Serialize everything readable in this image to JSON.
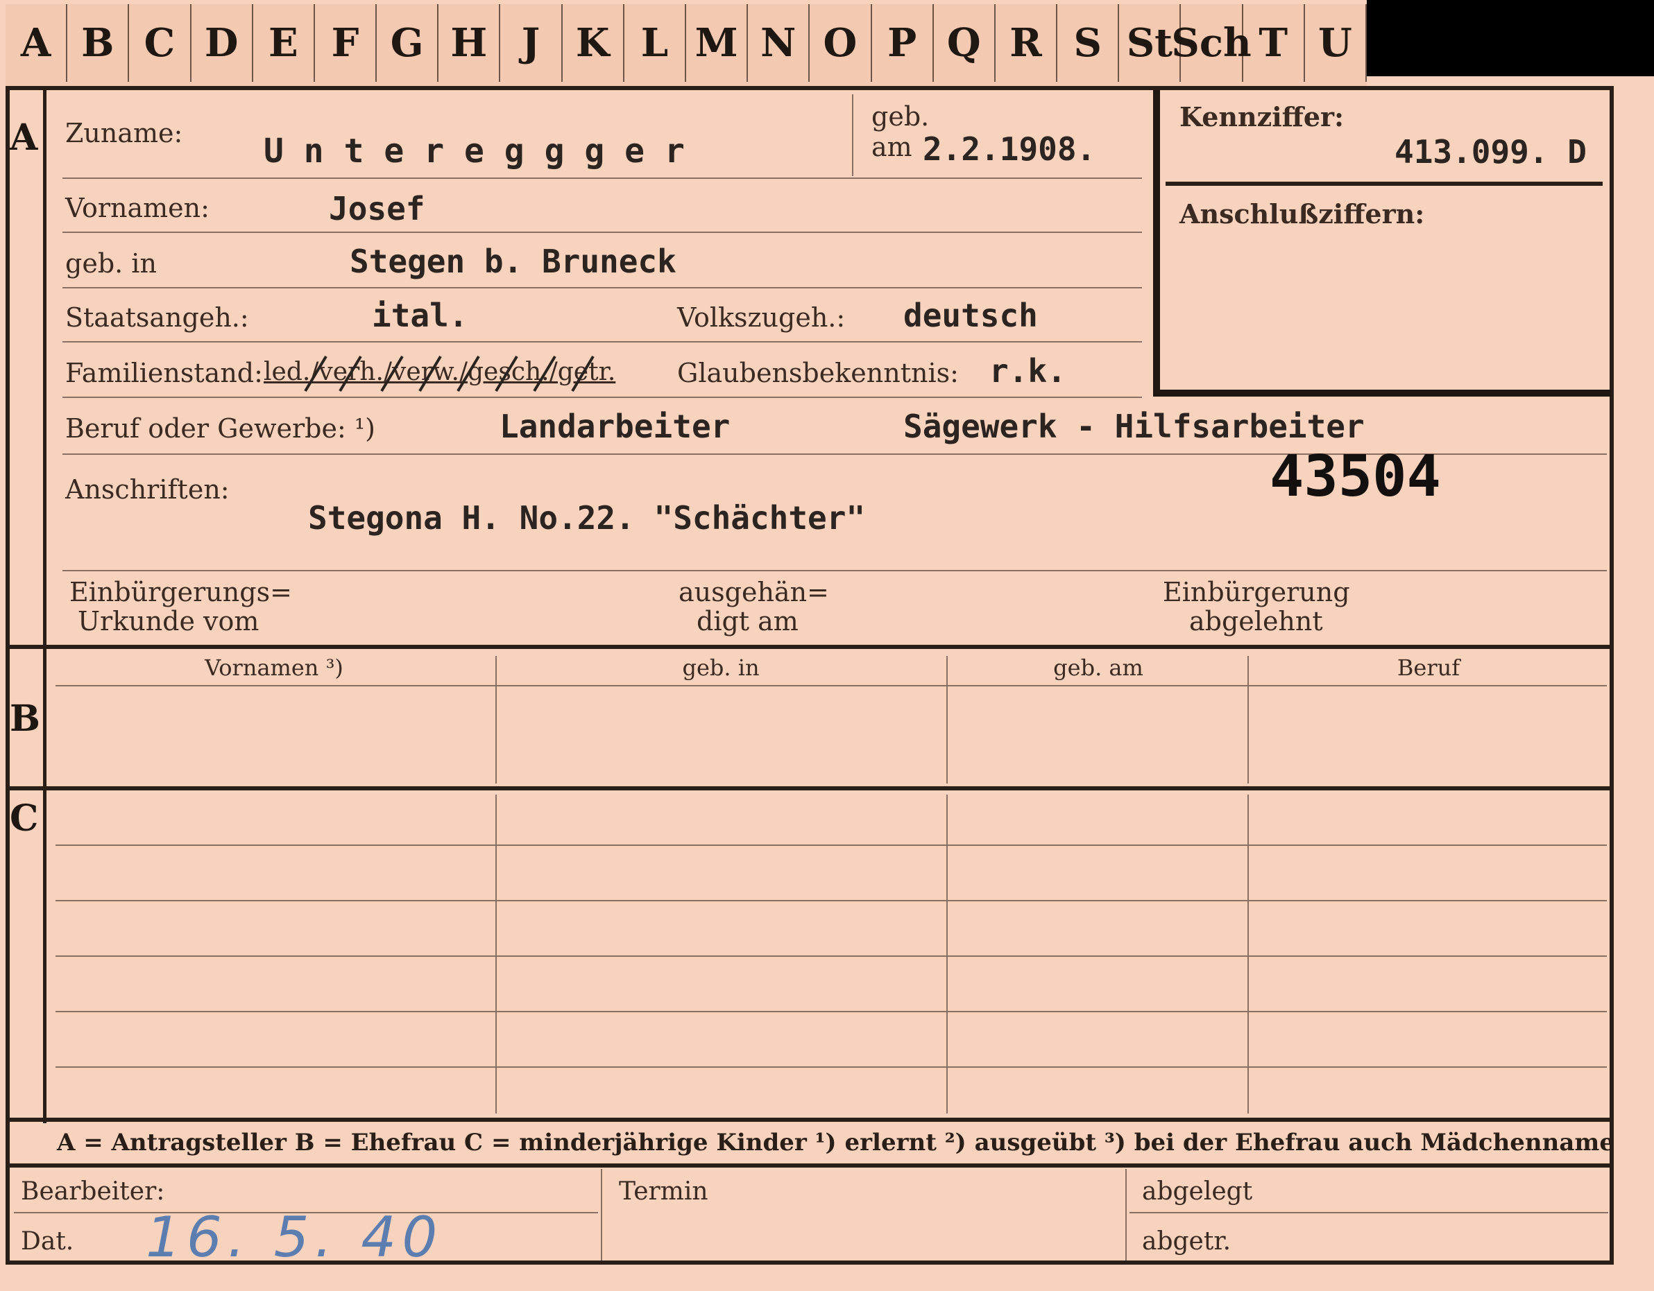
{
  "tabs": [
    "A",
    "B",
    "C",
    "D",
    "E",
    "F",
    "G",
    "H",
    "J",
    "K",
    "L",
    "M",
    "N",
    "O",
    "P",
    "Q",
    "R",
    "S",
    "St",
    "Sch",
    "T",
    "U"
  ],
  "section_a": {
    "letter": "A",
    "surname_label": "Zuname:",
    "surname_value": "U n t e r e g g g e r",
    "born_label_1": "geb.",
    "born_label_2": "am",
    "born_value": "2.2.1908.",
    "kennziffer_label": "Kennziffer:",
    "kennziffer_value": "413.099. D",
    "anschluss_label": "Anschlußziffern:",
    "vornamen_label": "Vornamen:",
    "vornamen_value": "Josef",
    "gebin_label": "geb. in",
    "gebin_value": "Stegen b. Bruneck",
    "staats_label": "Staatsangeh.:",
    "staats_value": "ital.",
    "volks_label": "Volkszugeh.:",
    "volks_value": "deutsch",
    "familien_label": "Familienstand:",
    "familien_options": "led./verh./verw./gesch./getr.",
    "glauben_label": "Glaubensbekenntnis:",
    "glauben_value": "r.k.",
    "beruf_label": "Beruf oder Gewerbe: ¹)",
    "beruf_value_1": "Landarbeiter",
    "beruf_value_2": "Sägewerk - Hilfsarbeiter",
    "stamp_number": "43504",
    "anschriften_label": "Anschriften:",
    "anschriften_value": "Stegona H. No.22.  \"Schächter\"",
    "einb_label_1": "Einbürgerungs=",
    "einb_label_2": "Urkunde vom",
    "ausg_label_1": "ausgehän=",
    "ausg_label_2": "digt am",
    "abgelehnt_label_1": "Einbürgerung",
    "abgelehnt_label_2": "abgelehnt"
  },
  "section_b": {
    "letter": "B",
    "columns": [
      "Vornamen ³)",
      "geb. in",
      "geb. am",
      "Beruf"
    ]
  },
  "section_c": {
    "letter": "C"
  },
  "legend": {
    "text": "A = Antragsteller   B = Ehefrau   C = minderjährige Kinder   ¹) erlernt   ²) ausgeübt   ³) bei der Ehefrau auch Mädchenname"
  },
  "footer": {
    "bearbeiter_label": "Bearbeiter:",
    "dat_label": "Dat.",
    "dat_value": "16. 5. 40",
    "termin_label": "Termin",
    "abgelegt_label": "abgelegt",
    "abgetr_label": "abgetr."
  }
}
